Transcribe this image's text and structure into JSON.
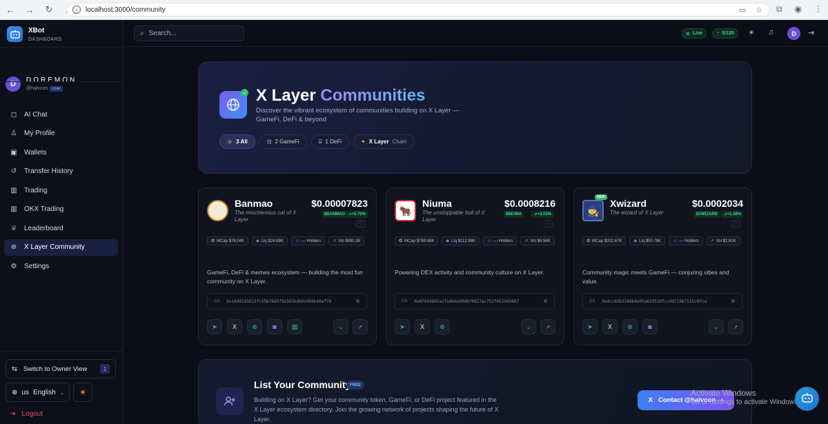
{
  "browser": {
    "url": "localhost:3000/community"
  },
  "sidebar": {
    "brand_name": "XBot",
    "brand_sub": "DASHBOARD",
    "user_initial": "D",
    "user_name": "DOREMON",
    "user_handle": "@halvcon",
    "user_role": "User",
    "items": [
      {
        "label": "AI Chat",
        "icon": "chat-icon"
      },
      {
        "label": "My Profile",
        "icon": "user-icon"
      },
      {
        "label": "Wallets",
        "icon": "wallet-icon"
      },
      {
        "label": "Transfer History",
        "icon": "history-icon"
      },
      {
        "label": "Trading",
        "icon": "bar-chart-icon"
      },
      {
        "label": "OKX Trading",
        "icon": "bar-chart-icon"
      },
      {
        "label": "Leaderboard",
        "icon": "trophy-icon"
      },
      {
        "label": "X Layer Community",
        "icon": "globe-icon",
        "active": true
      },
      {
        "label": "Settings",
        "icon": "gear-icon"
      }
    ],
    "owner_view_label": "Switch to Owner View",
    "owner_view_badge": "1",
    "lang_code": "us",
    "lang_label": "English",
    "logout_label": "Logout"
  },
  "topbar": {
    "search_placeholder": "Search...",
    "live_label": "Live",
    "quota_label": "0/120",
    "user_initial": "D"
  },
  "hero": {
    "title_part1": "X Layer",
    "title_part2": "Communities",
    "description": "Discover the vibrant ecosystem of communities building on X Layer — GameFi, DeFi & beyond",
    "filters": [
      {
        "label": "3 All",
        "active": true
      },
      {
        "label": "2 GameFi"
      },
      {
        "label": "1 DeFi"
      }
    ],
    "chain_strong": "X Layer",
    "chain_muted": "Chain"
  },
  "cards": [
    {
      "name": "Banmao",
      "tagline": "The mischievous cat of X Layer",
      "price": "$0.00007823",
      "symbol": "$BANMAO",
      "change": "+5.70%",
      "mcap": "MCap $78.04K",
      "liq": "Liq $24.89K",
      "holders": "— Holders",
      "vol": "Vol $890.38",
      "description": "GameFi, DeFi & memes ecosystem — building the most fun community on X Layer.",
      "ca_label": "CA",
      "ca": "0x16d91d1615fc55b76d5f92365bd60c069b46ef78"
    },
    {
      "name": "Niuma",
      "tagline": "The unstoppable bull of X Layer",
      "price": "$0.0008216",
      "symbol": "$NIUMA",
      "change": "+3.03%",
      "mcap": "MCap $799.68K",
      "liq": "Liq $112.98K",
      "holders": "— Holders",
      "vol": "Vol $6.56K",
      "description": "Powering DEX activity and community culture on X Layer.",
      "ca_label": "CA",
      "ca": "0x87669801a1fad6dad9db70d27ac752f452989667"
    },
    {
      "name": "Xwizard",
      "tagline": "The wizard of X Layer",
      "price": "$0.0002034",
      "symbol": "$XWIZARD",
      "change": "+1.38%",
      "new_label": "NEW",
      "mcap": "MCap $202.67K",
      "liq": "Liq $50.78K",
      "holders": "— Holders",
      "vol": "Vol $2.61K",
      "description": "Community magic meets GameFi — conjuring vibes and value.",
      "ca_label": "CA",
      "ca": "0xdcc83b32b6b4e95a61951bfcc9d71967515c0fca"
    }
  ],
  "list_community": {
    "title": "List Your Community",
    "badge": "FREE",
    "text": "Building on X Layer? Get your community token, GameFi, or DeFi project featured in the X Layer ecosystem directory. Join the growing network of projects shaping the future of X Layer."
  },
  "contact_label": "Contact @halvcon",
  "watermark": {
    "line1": "Activate Windows",
    "line2": "Go to Settings to activate Windows."
  },
  "colors": {
    "accent": "#3a8ef0",
    "active_nav": "#182240",
    "positive": "#3ed68f",
    "logout": "#e0545c"
  }
}
